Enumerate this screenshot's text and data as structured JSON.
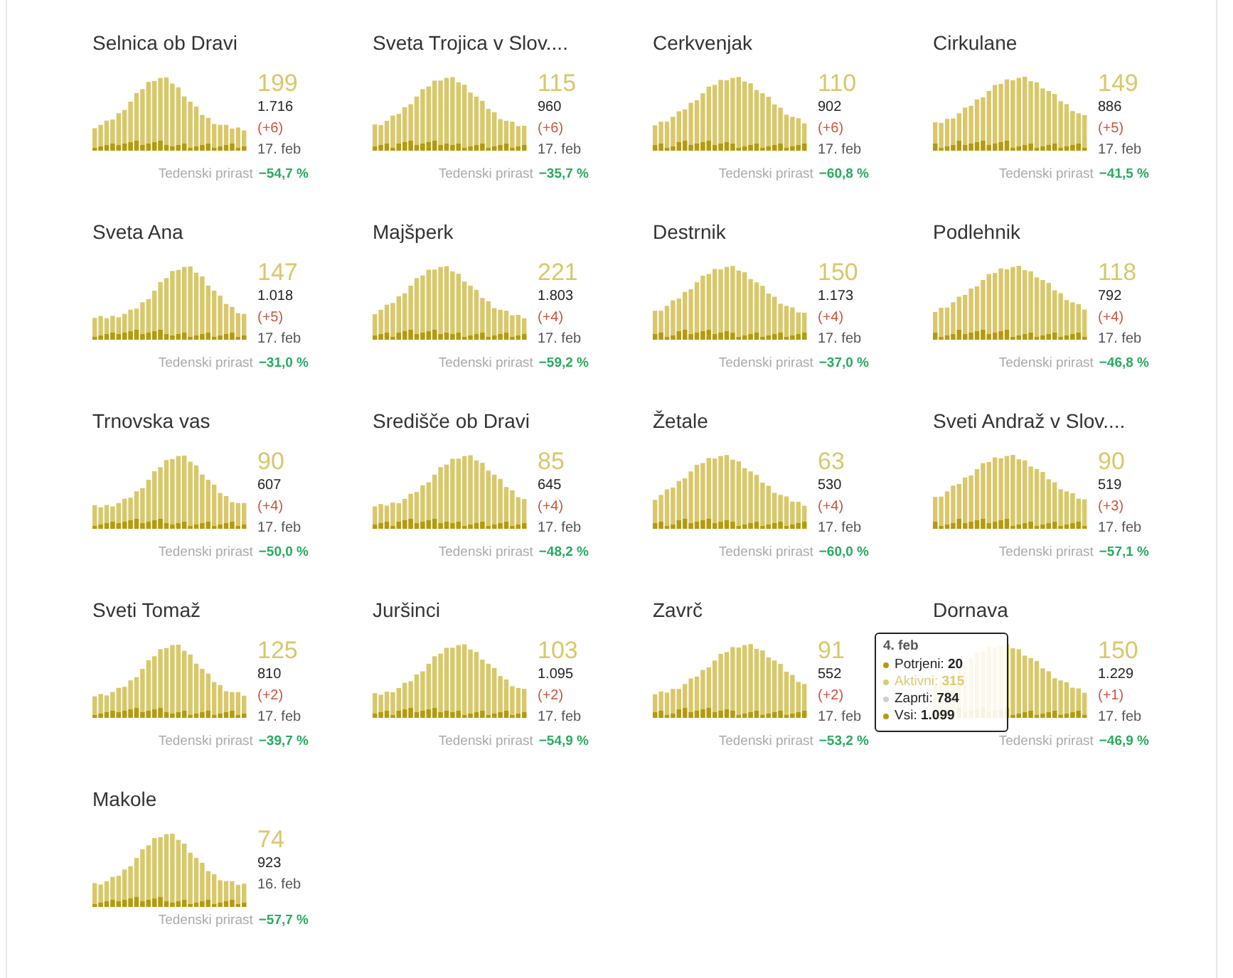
{
  "cards": [
    {
      "title": "Selnica ob Dravi",
      "active": "199",
      "total": "1.716",
      "delta": "(+6)",
      "date": "17. feb",
      "growth_label": "Tedenski prirast",
      "growth": "−54,7 %"
    },
    {
      "title": "Sveta Trojica v Slov....",
      "active": "115",
      "total": "960",
      "delta": "(+6)",
      "date": "17. feb",
      "growth_label": "Tedenski prirast",
      "growth": "−35,7 %"
    },
    {
      "title": "Cerkvenjak",
      "active": "110",
      "total": "902",
      "delta": "(+6)",
      "date": "17. feb",
      "growth_label": "Tedenski prirast",
      "growth": "−60,8 %"
    },
    {
      "title": "Cirkulane",
      "active": "149",
      "total": "886",
      "delta": "(+5)",
      "date": "17. feb",
      "growth_label": "Tedenski prirast",
      "growth": "−41,5 %"
    },
    {
      "title": "Sveta Ana",
      "active": "147",
      "total": "1.018",
      "delta": "(+5)",
      "date": "17. feb",
      "growth_label": "Tedenski prirast",
      "growth": "−31,0 %"
    },
    {
      "title": "Majšperk",
      "active": "221",
      "total": "1.803",
      "delta": "(+4)",
      "date": "17. feb",
      "growth_label": "Tedenski prirast",
      "growth": "−59,2 %"
    },
    {
      "title": "Destrnik",
      "active": "150",
      "total": "1.173",
      "delta": "(+4)",
      "date": "17. feb",
      "growth_label": "Tedenski prirast",
      "growth": "−37,0 %"
    },
    {
      "title": "Podlehnik",
      "active": "118",
      "total": "792",
      "delta": "(+4)",
      "date": "17. feb",
      "growth_label": "Tedenski prirast",
      "growth": "−46,8 %"
    },
    {
      "title": "Trnovska vas",
      "active": "90",
      "total": "607",
      "delta": "(+4)",
      "date": "17. feb",
      "growth_label": "Tedenski prirast",
      "growth": "−50,0 %"
    },
    {
      "title": "Središče ob Dravi",
      "active": "85",
      "total": "645",
      "delta": "(+4)",
      "date": "17. feb",
      "growth_label": "Tedenski prirast",
      "growth": "−48,2 %"
    },
    {
      "title": "Žetale",
      "active": "63",
      "total": "530",
      "delta": "(+4)",
      "date": "17. feb",
      "growth_label": "Tedenski prirast",
      "growth": "−60,0 %"
    },
    {
      "title": "Sveti Andraž v Slov....",
      "active": "90",
      "total": "519",
      "delta": "(+3)",
      "date": "17. feb",
      "growth_label": "Tedenski prirast",
      "growth": "−57,1 %"
    },
    {
      "title": "Sveti Tomaž",
      "active": "125",
      "total": "810",
      "delta": "(+2)",
      "date": "17. feb",
      "growth_label": "Tedenski prirast",
      "growth": "−39,7 %"
    },
    {
      "title": "Juršinci",
      "active": "103",
      "total": "1.095",
      "delta": "(+2)",
      "date": "17. feb",
      "growth_label": "Tedenski prirast",
      "growth": "−54,9 %"
    },
    {
      "title": "Zavrč",
      "active": "91",
      "total": "552",
      "delta": "(+2)",
      "date": "17. feb",
      "growth_label": "Tedenski prirast",
      "growth": "−53,2 %"
    },
    {
      "title": "Dornava",
      "active": "150",
      "total": "1.229",
      "delta": "(+1)",
      "date": "17. feb",
      "growth_label": "Tedenski prirast",
      "growth": "−46,9 %",
      "tooltip": {
        "title": "4. feb",
        "items": [
          {
            "text": "Potrjeni: **20**",
            "color": "#b39a10",
            "dimmed": false
          },
          {
            "text": "Aktivni: **315**",
            "color": "#dccb75",
            "dimmed": true
          },
          {
            "text": "Zaprti: **784**",
            "color": "#d0d0d0",
            "dimmed": false
          },
          {
            "text": "Vsi: **1.099**",
            "color": "#b39a10",
            "dimmed": false
          }
        ]
      }
    },
    {
      "title": "Makole",
      "active": "74",
      "total": "923",
      "date": "16. feb",
      "growth_label": "Tedenski prirast",
      "growth": "−57,7 %"
    }
  ]
}
